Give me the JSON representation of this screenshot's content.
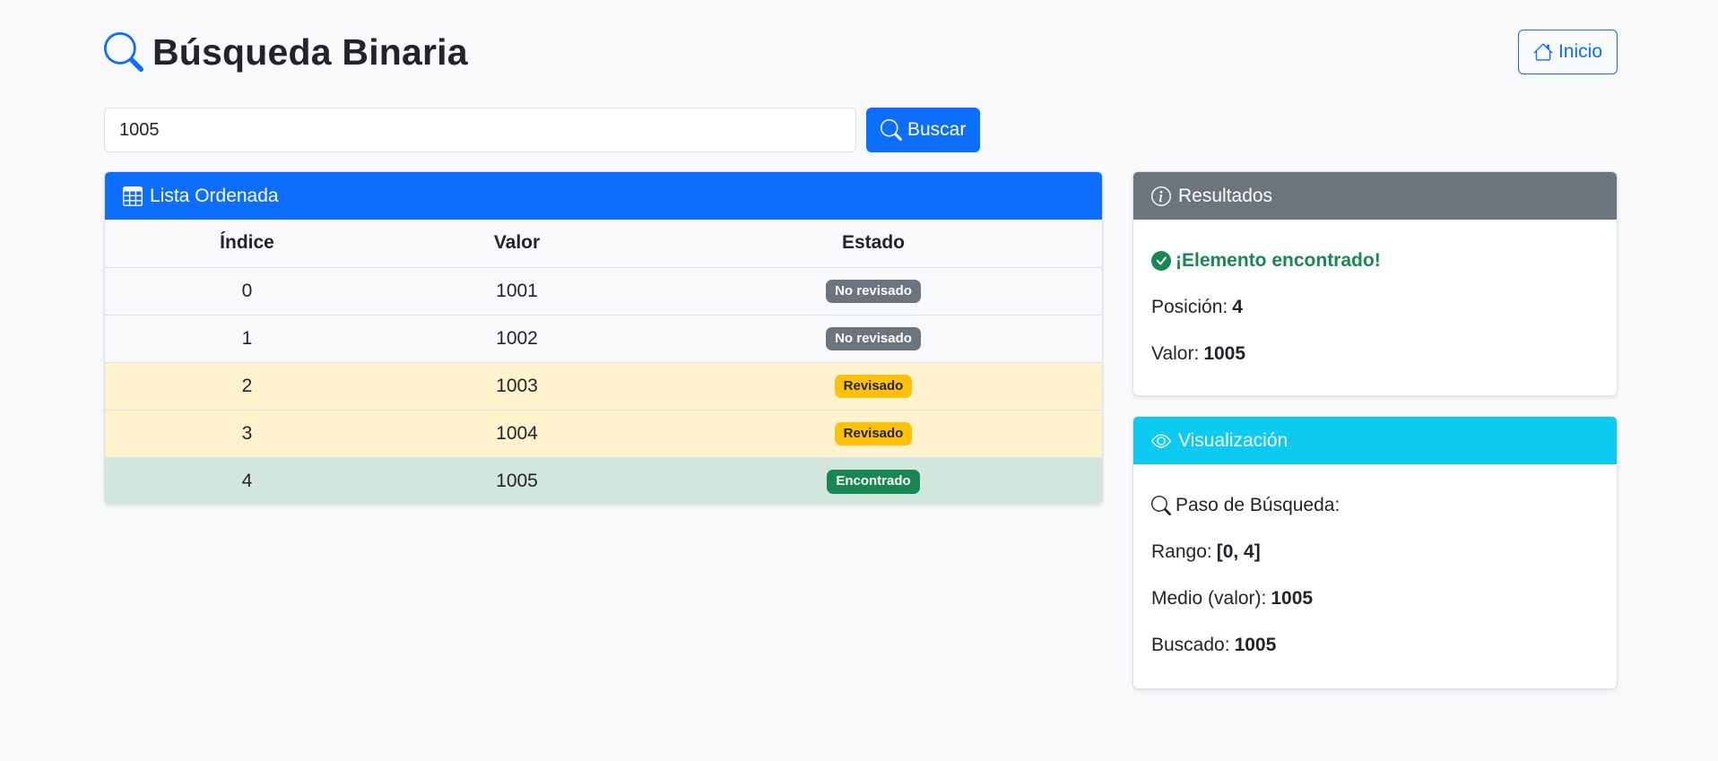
{
  "header": {
    "title": "Búsqueda Binaria",
    "home_label": "Inicio"
  },
  "search": {
    "value": "1005",
    "button_label": "Buscar"
  },
  "table_card": {
    "title": "Lista Ordenada",
    "columns": [
      "Índice",
      "Valor",
      "Estado"
    ],
    "rows": [
      {
        "index": "0",
        "value": "1001",
        "status": "No revisado"
      },
      {
        "index": "1",
        "value": "1002",
        "status": "No revisado"
      },
      {
        "index": "2",
        "value": "1003",
        "status": "Revisado"
      },
      {
        "index": "3",
        "value": "1004",
        "status": "Revisado"
      },
      {
        "index": "4",
        "value": "1005",
        "status": "Encontrado"
      }
    ]
  },
  "results": {
    "title": "Resultados",
    "found_message": "¡Elemento encontrado!",
    "position_label": "Posición:",
    "position_value": "4",
    "value_label": "Valor:",
    "value_value": "1005"
  },
  "visualization": {
    "title": "Visualización",
    "step_label": "Paso de Búsqueda:",
    "range_label": "Rango:",
    "range_value": "[0, 4]",
    "mid_label": "Medio (valor):",
    "mid_value": "1005",
    "sought_label": "Buscado:",
    "sought_value": "1005"
  },
  "colors": {
    "primary": "#0d6efd",
    "secondary": "#6c757d",
    "info": "#0dcaf0",
    "success": "#198754",
    "warning": "#ffc107"
  }
}
